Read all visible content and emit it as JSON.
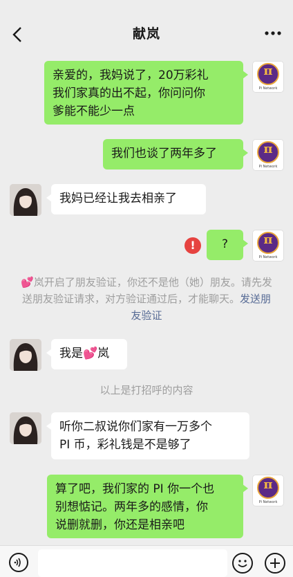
{
  "header": {
    "title": "献岚"
  },
  "messages": {
    "m1": "亲爱的，我妈说了，20万彩礼\n我们家真的出不起，你问问你\n爹能不能少一点",
    "m2": "我们也谈了两年多了",
    "m3": "我妈已经让我去相亲了",
    "m4": "?",
    "m5": "我是💕岚",
    "m6": "听你二叔说你们家有一万多个\nPI 币，彩礼钱是不是够了",
    "m7": "算了吧，我们家的 PI 你一个也\n别想惦记。两年多的感情，你\n说删就删，你还是相亲吧"
  },
  "system": {
    "verify_text": "💕岚开启了朋友验证，你还不是他（她）朋友。请先发送朋友验证请求，对方验证通过后，才能聊天。",
    "verify_link": "发送朋友验证",
    "greeting_note": "以上是打招呼的内容"
  },
  "avatar": {
    "pi_symbol": "π",
    "pi_caption": "Pi Network"
  },
  "icons": {
    "error": "!"
  },
  "colors": {
    "outgoing": "#95ec69",
    "incoming": "#ffffff",
    "link": "#576b95",
    "error": "#e64340"
  }
}
